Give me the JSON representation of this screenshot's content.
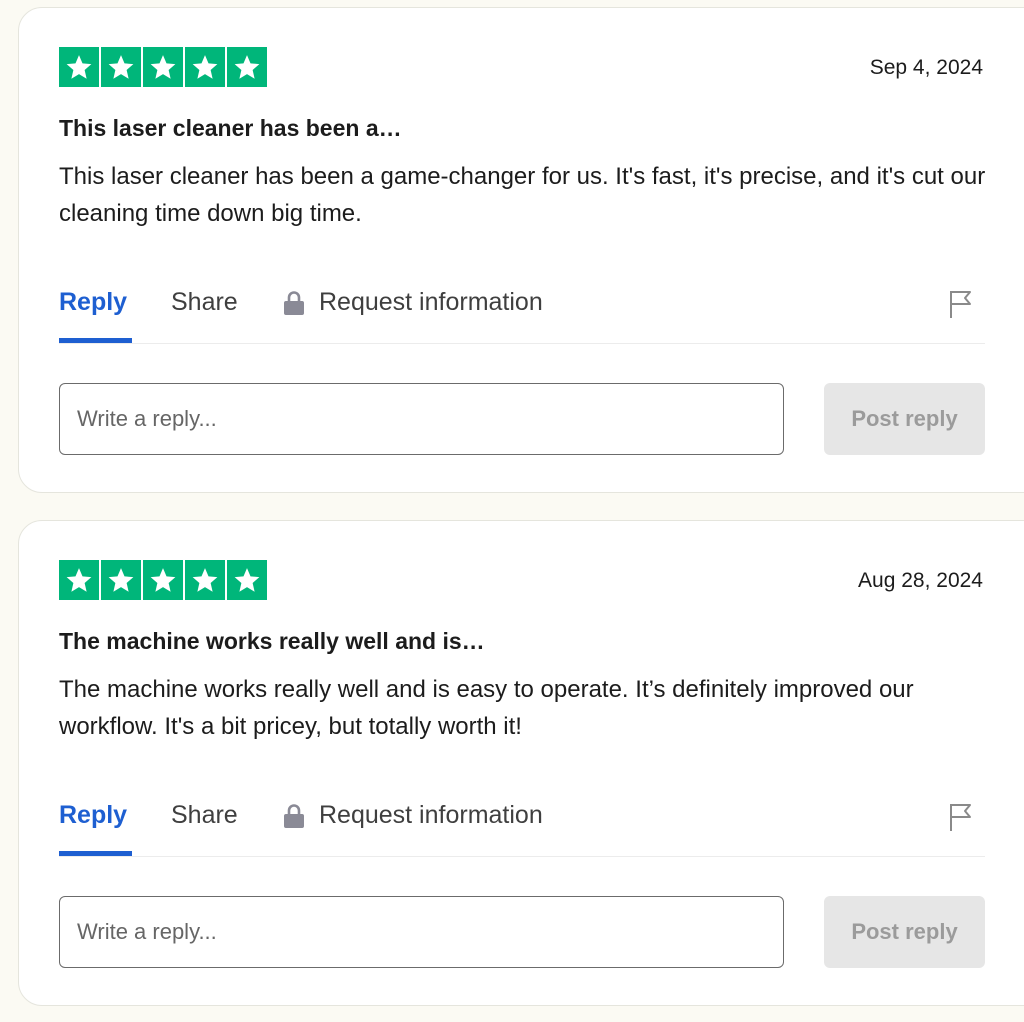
{
  "colors": {
    "star_green": "#00b67a",
    "accent_blue": "#1e5fd1",
    "page_bg": "#fbfaf3"
  },
  "reviews": [
    {
      "rating": 5,
      "date": "Sep 4, 2024",
      "title": "This laser cleaner has been a…",
      "body": "This laser cleaner has been a game-changer for us. It's fast, it's precise, and it's cut our cleaning time down big time.",
      "actions": {
        "reply": "Reply",
        "share": "Share",
        "request": "Request information",
        "lock_icon": "lock-icon",
        "flag_icon": "flag-icon"
      },
      "reply_placeholder": "Write a reply...",
      "post_reply": "Post reply"
    },
    {
      "rating": 5,
      "date": "Aug 28, 2024",
      "title": "The machine works really well and is…",
      "body": "The machine works really well and is easy to operate. It’s definitely improved our workflow. It's a bit pricey, but totally worth it!",
      "actions": {
        "reply": "Reply",
        "share": "Share",
        "request": "Request information",
        "lock_icon": "lock-icon",
        "flag_icon": "flag-icon"
      },
      "reply_placeholder": "Write a reply...",
      "post_reply": "Post reply"
    }
  ]
}
